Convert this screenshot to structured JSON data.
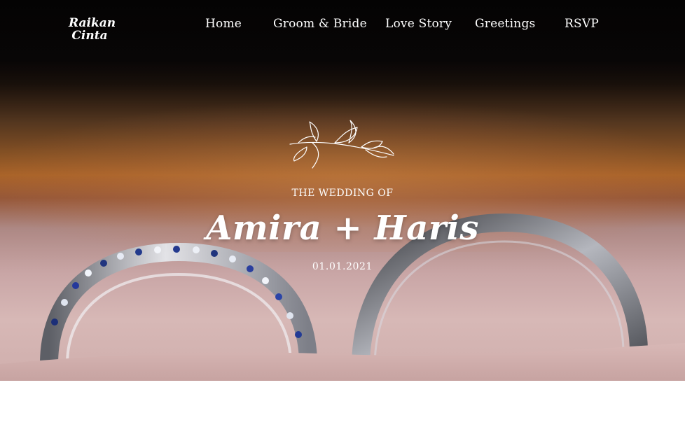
{
  "brand": {
    "line1": "Raikan",
    "line2": "Cinta"
  },
  "nav": [
    {
      "label": "Home"
    },
    {
      "label": "Groom & Bride"
    },
    {
      "label": "Love Story"
    },
    {
      "label": "Greetings"
    },
    {
      "label": "RSVP"
    }
  ],
  "hero": {
    "eyebrow": "THE WEDDING OF",
    "couple": "Amira + Haris",
    "date": "01.01.2021",
    "image_subject": "wedding rings"
  },
  "icons": {
    "ornament": "leaf-sprig-icon"
  },
  "colors": {
    "text": "#ffffff",
    "page_bg": "#ffffff"
  }
}
